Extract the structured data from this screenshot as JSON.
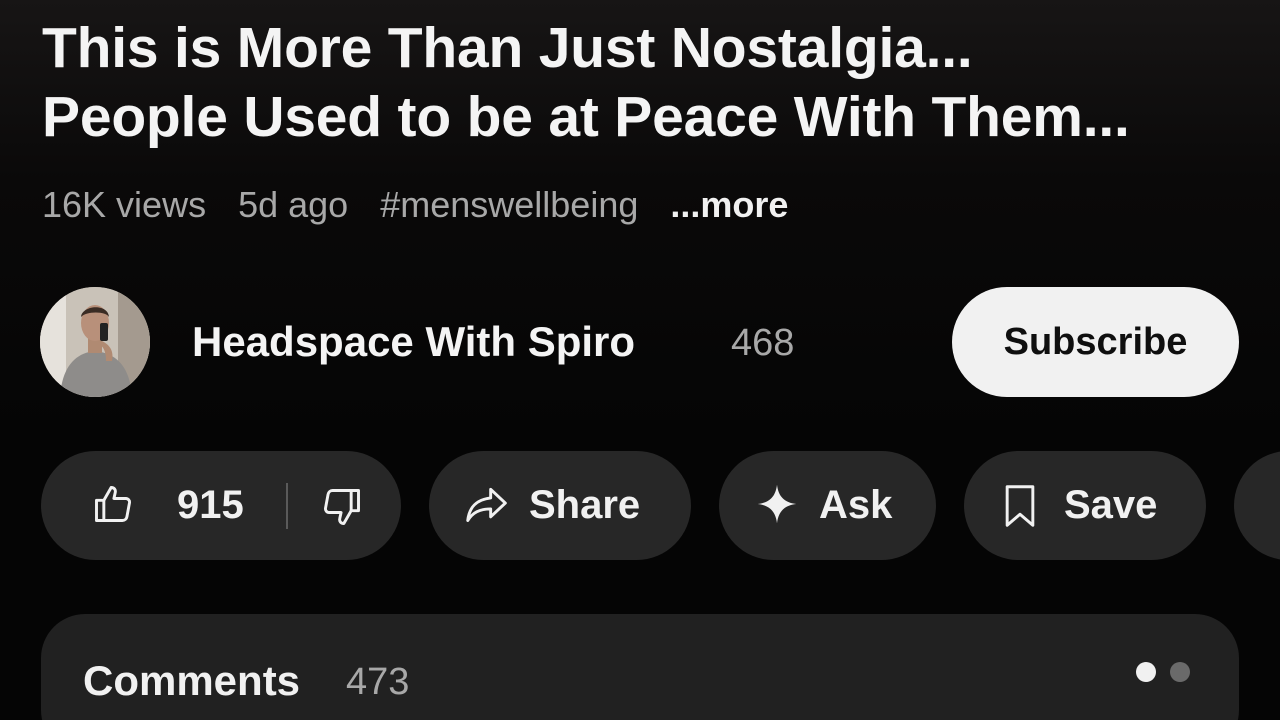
{
  "video": {
    "title_line1": "This is More Than Just Nostalgia...",
    "title_line2": "People Used to be at Peace With Them...",
    "views": "16K views",
    "age": "5d ago",
    "hashtag": "#menswellbeing",
    "more_label": "...more"
  },
  "channel": {
    "name": "Headspace With Spiro",
    "subscribers": "468",
    "subscribe_label": "Subscribe",
    "avatar_icon": "channel-avatar-photo"
  },
  "actions": {
    "like_count": "915",
    "like_icon": "thumbs-up-icon",
    "dislike_icon": "thumbs-down-icon",
    "share_label": "Share",
    "share_icon": "share-arrow-icon",
    "ask_label": "Ask",
    "ask_icon": "sparkle-icon",
    "save_label": "Save",
    "save_icon": "bookmark-icon",
    "more_icon": "more-actions-icon"
  },
  "comments": {
    "title": "Comments",
    "count": "473",
    "pager_pages": 2,
    "pager_active": 1
  },
  "colors": {
    "background": "#050505",
    "pill_background": "#272727",
    "subscribe_background": "#f1f1f1",
    "text_primary": "#f1f1f1",
    "text_secondary": "#a8a8a8"
  }
}
